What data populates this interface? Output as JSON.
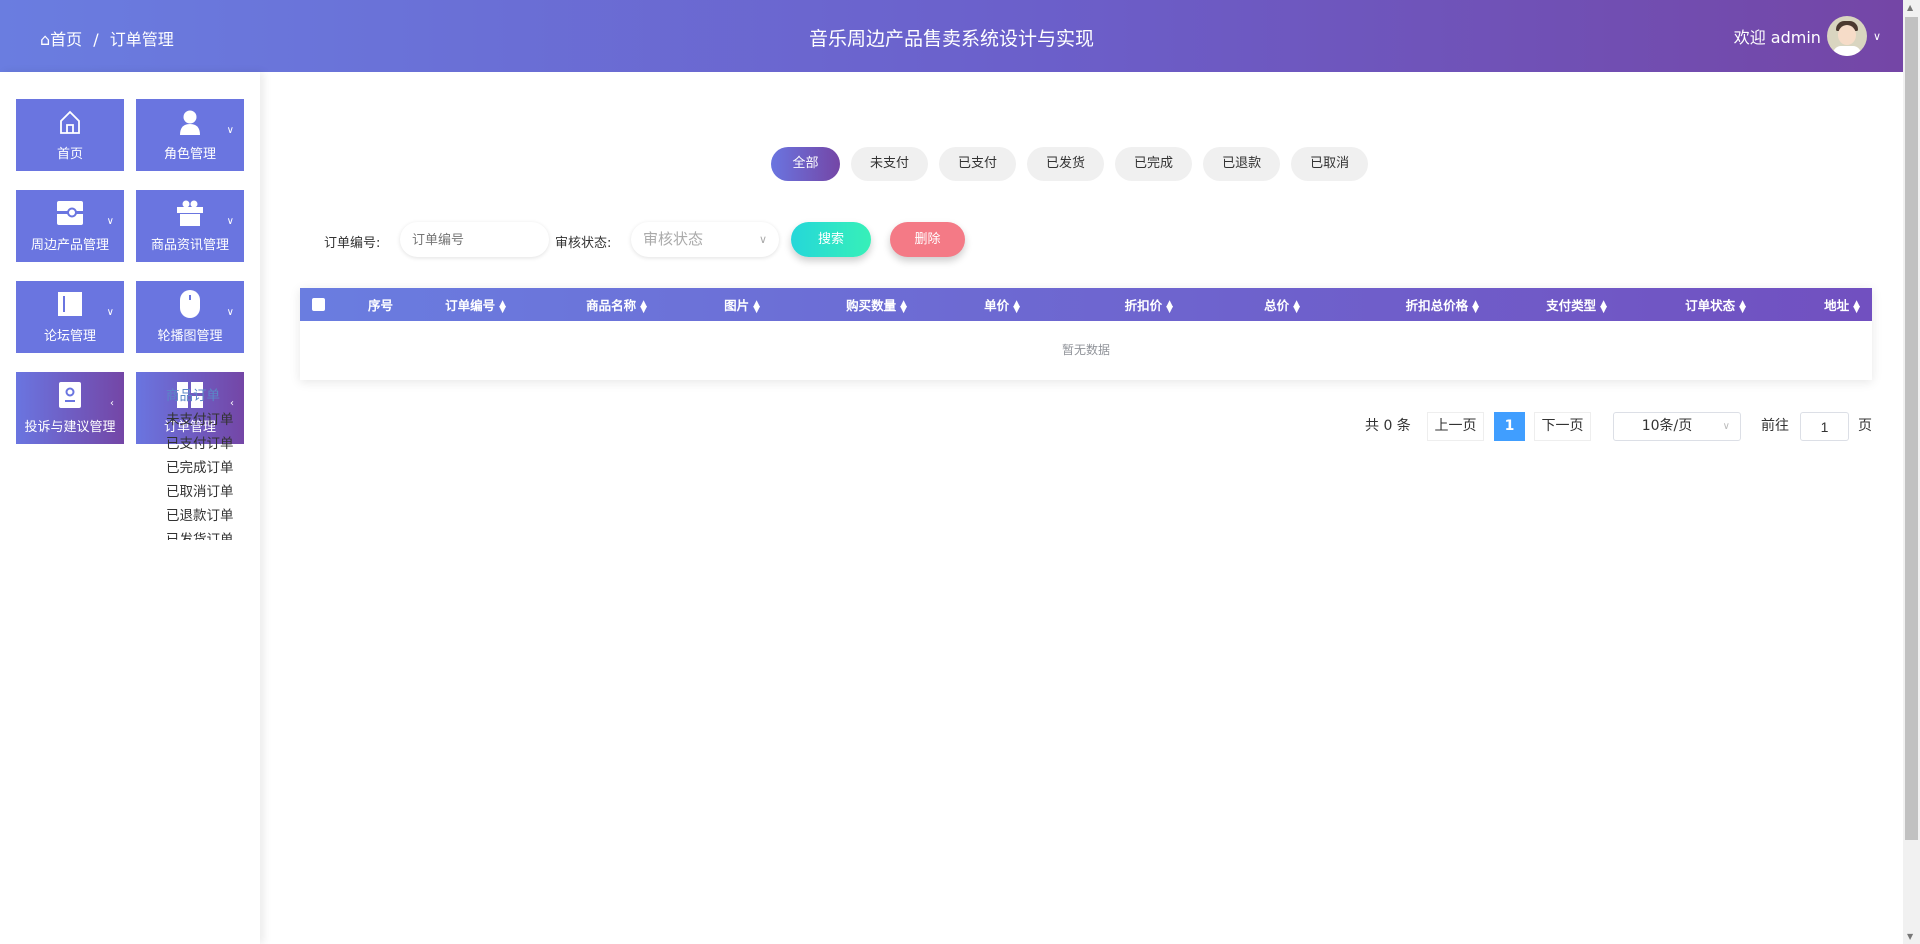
{
  "header": {
    "breadcrumb_home": "首页",
    "breadcrumb_sep": "/",
    "breadcrumb_current": "订单管理",
    "title": "音乐周边产品售卖系统设计与实现",
    "welcome": "欢迎 admin"
  },
  "sidebar": {
    "tiles": [
      {
        "label": "首页",
        "icon": "home-icon",
        "has_children": false
      },
      {
        "label": "角色管理",
        "icon": "user-icon",
        "has_children": true
      },
      {
        "label": "周边产品管理",
        "icon": "product-icon",
        "has_children": true
      },
      {
        "label": "商品资讯管理",
        "icon": "gift-icon",
        "has_children": true
      },
      {
        "label": "论坛管理",
        "icon": "forum-icon",
        "has_children": true
      },
      {
        "label": "轮播图管理",
        "icon": "mouse-icon",
        "has_children": true
      },
      {
        "label": "投诉与建议管理",
        "icon": "feedback-icon",
        "has_children": true
      },
      {
        "label": "订单管理",
        "icon": "layout-icon",
        "has_children": true
      }
    ],
    "submenu": [
      "商品订单",
      "未支付订单",
      "已支付订单",
      "已完成订单",
      "已取消订单",
      "已退款订单",
      "已发货订单"
    ],
    "submenu_active": "商品订单"
  },
  "filters": {
    "tabs": [
      "全部",
      "未支付",
      "已支付",
      "已发货",
      "已完成",
      "已退款",
      "已取消"
    ],
    "active": "全部"
  },
  "search": {
    "order_no_label": "订单编号:",
    "order_no_placeholder": "订单编号",
    "order_no_value": "",
    "status_label": "审核状态:",
    "status_placeholder": "审核状态",
    "search_button": "搜索",
    "delete_button": "删除"
  },
  "table": {
    "columns": [
      "序号",
      "订单编号",
      "商品名称",
      "图片",
      "购买数量",
      "单价",
      "折扣价",
      "总价",
      "折扣总价格",
      "支付类型",
      "订单状态",
      "地址"
    ],
    "rows": [],
    "empty_text": "暂无数据"
  },
  "pagination": {
    "total": "共 0 条",
    "prev": "上一页",
    "current_page": "1",
    "next": "下一页",
    "page_size": "10条/页",
    "goto_label": "前往",
    "goto_value": "1",
    "goto_suffix": "页"
  },
  "colors": {
    "header_start": "#6a7de0",
    "header_end": "#7446a6",
    "search_button": "#2fe0c8",
    "delete_button": "#f47a86",
    "active_page": "#409eff"
  }
}
